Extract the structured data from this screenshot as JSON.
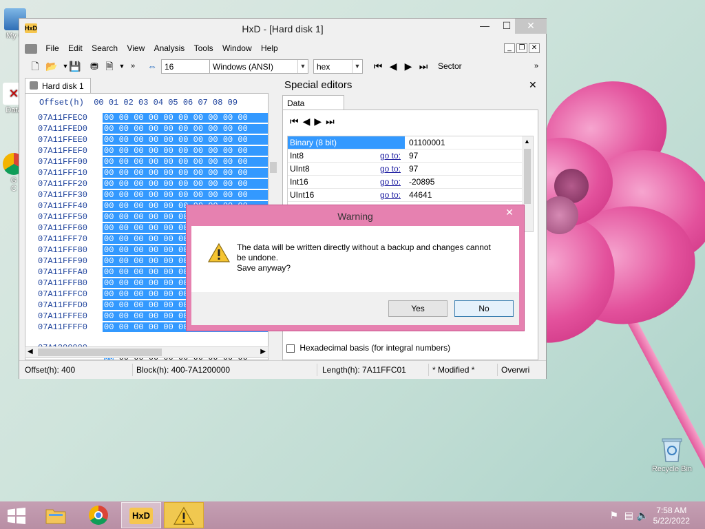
{
  "window": {
    "title": "HxD - [Hard disk 1]",
    "app_icon_text": "HxD"
  },
  "menu": [
    "File",
    "Edit",
    "Search",
    "View",
    "Analysis",
    "Tools",
    "Window",
    "Help"
  ],
  "toolbar": {
    "bytes_per_row": "16",
    "charset": "Windows (ANSI)",
    "offset_base": "hex",
    "section_label": "Sector"
  },
  "hex_editor": {
    "tab_label": "Hard disk 1",
    "header": "Offset(h)  00 01 02 03 04 05 06 07 08 09",
    "rows": [
      {
        "offset": "07A11FFEC0",
        "bytes": "00 00 00 00 00 00 00 00 00 00"
      },
      {
        "offset": "07A11FFED0",
        "bytes": "00 00 00 00 00 00 00 00 00 00"
      },
      {
        "offset": "07A11FFEE0",
        "bytes": "00 00 00 00 00 00 00 00 00 00"
      },
      {
        "offset": "07A11FFEF0",
        "bytes": "00 00 00 00 00 00 00 00 00 00"
      },
      {
        "offset": "07A11FFF00",
        "bytes": "00 00 00 00 00 00 00 00 00 00"
      },
      {
        "offset": "07A11FFF10",
        "bytes": "00 00 00 00 00 00 00 00 00 00"
      },
      {
        "offset": "07A11FFF20",
        "bytes": "00 00 00 00 00 00 00 00 00 00"
      },
      {
        "offset": "07A11FFF30",
        "bytes": "00 00 00 00 00 00 00 00 00 00"
      },
      {
        "offset": "07A11FFF40",
        "bytes": "00 00 00 00 00 00 00 00 00 00"
      },
      {
        "offset": "07A11FFF50",
        "bytes": "00 00 00 00 00 00 00 00 00 00"
      },
      {
        "offset": "07A11FFF60",
        "bytes": "00 00 00 00 00 00 00 00 00 00"
      },
      {
        "offset": "07A11FFF70",
        "bytes": "00 00 00 00 00 00 00 00 00 00"
      },
      {
        "offset": "07A11FFF80",
        "bytes": "00 00 00 00 00 00 00 00 00 00"
      },
      {
        "offset": "07A11FFF90",
        "bytes": "00 00 00 00 00 00 00 00 00 00"
      },
      {
        "offset": "07A11FFFA0",
        "bytes": "00 00 00 00 00 00 00 00 00 00"
      },
      {
        "offset": "07A11FFFB0",
        "bytes": "00 00 00 00 00 00 00 00 00 00"
      },
      {
        "offset": "07A11FFFC0",
        "bytes": "00 00 00 00 00 00 00 00 00 00"
      },
      {
        "offset": "07A11FFFD0",
        "bytes": "00 00 00 00 00 00 00 00 00 00"
      },
      {
        "offset": "07A11FFFE0",
        "bytes": "00 00 00 00 00 00 00 00 00 00"
      },
      {
        "offset": "07A11FFFF0",
        "bytes": "00 00 00 00 00 00 00 00 00 00"
      }
    ],
    "last_row": {
      "offset": "07A1200000",
      "first": "00",
      "rest": " 00 00 00 00 00 00 00 00 00"
    }
  },
  "special_editors": {
    "title": "Special editors",
    "tab_label": "Data inspector",
    "rows": [
      {
        "label": "Binary (8 bit)",
        "goto": "",
        "value": "01100001",
        "selected": true
      },
      {
        "label": "Int8",
        "goto": "go to:",
        "value": "97"
      },
      {
        "label": "UInt8",
        "goto": "go to:",
        "value": "97"
      },
      {
        "label": "Int16",
        "goto": "go to:",
        "value": "-20895"
      },
      {
        "label": "UInt16",
        "goto": "go to:",
        "value": "44641"
      }
    ],
    "hex_basis_label": "Hexadecimal basis (for integral numbers)"
  },
  "status": {
    "offset": "Offset(h): 400",
    "block": "Block(h): 400-7A1200000",
    "length": "Length(h): 7A11FFC01",
    "modified": "* Modified *",
    "mode": "Overwri"
  },
  "dialog": {
    "title": "Warning",
    "message_line1": "The data will be written directly without a backup and changes cannot",
    "message_line2": "be undone.",
    "message_line3": "Save anyway?",
    "yes": "Yes",
    "no": "No"
  },
  "desktop": {
    "icon_labels": [
      "My C",
      "Data",
      "G",
      "C"
    ],
    "recycle_bin": "Recycle Bin"
  },
  "taskbar": {
    "time": "7:58 AM",
    "date": "5/22/2022"
  },
  "colors": {
    "selection": "#3399ff",
    "dialog_frame": "#e681b0",
    "taskbar": "#bd95aa"
  }
}
